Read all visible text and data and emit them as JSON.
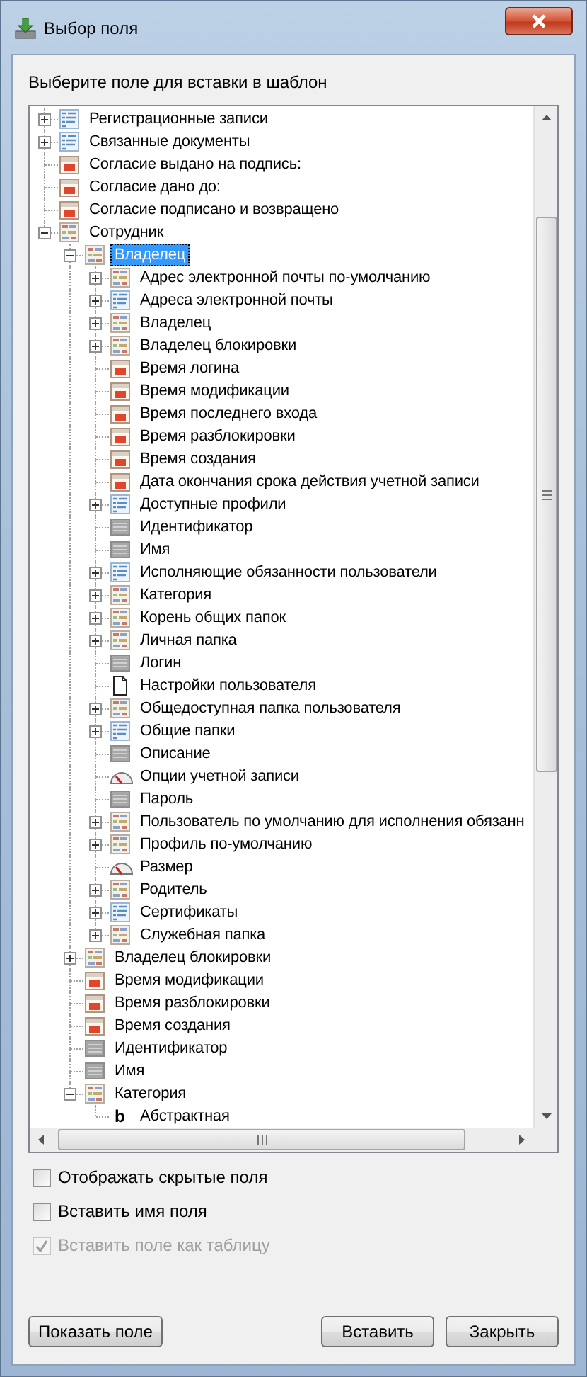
{
  "window": {
    "title": "Выбор поля"
  },
  "prompt": "Выберите поле для вставки в шаблон",
  "tree": [
    {
      "label": "Регистрационные записи",
      "kind": "list",
      "expanded": false,
      "selected": false
    },
    {
      "label": "Связанные документы",
      "kind": "list",
      "expanded": false,
      "selected": false
    },
    {
      "label": "Согласие выдано на подпись:",
      "kind": "date",
      "selected": false
    },
    {
      "label": "Согласие дано до:",
      "kind": "date",
      "selected": false
    },
    {
      "label": "Согласие подписано и возвращено",
      "kind": "date",
      "selected": false
    },
    {
      "label": "Сотрудник",
      "kind": "entity",
      "expanded": true,
      "selected": false,
      "children": [
        {
          "label": "Владелец",
          "kind": "entity",
          "expanded": true,
          "selected": true,
          "children": [
            {
              "label": "Адрес электронной почты по-умолчанию",
              "kind": "entity",
              "expanded": false,
              "selected": false
            },
            {
              "label": "Адреса электронной почты",
              "kind": "list",
              "expanded": false,
              "selected": false
            },
            {
              "label": "Владелец",
              "kind": "entity",
              "expanded": false,
              "selected": false
            },
            {
              "label": "Владелец блокировки",
              "kind": "entity",
              "expanded": false,
              "selected": false
            },
            {
              "label": "Время логина",
              "kind": "date",
              "selected": false
            },
            {
              "label": "Время модификации",
              "kind": "date",
              "selected": false
            },
            {
              "label": "Время последнего входа",
              "kind": "date",
              "selected": false
            },
            {
              "label": "Время разблокировки",
              "kind": "date",
              "selected": false
            },
            {
              "label": "Время создания",
              "kind": "date",
              "selected": false
            },
            {
              "label": "Дата окончания срока действия учетной записи",
              "kind": "date",
              "selected": false
            },
            {
              "label": "Доступные профили",
              "kind": "list",
              "expanded": false,
              "selected": false
            },
            {
              "label": "Идентификатор",
              "kind": "text",
              "selected": false
            },
            {
              "label": "Имя",
              "kind": "text",
              "selected": false
            },
            {
              "label": "Исполняющие обязанности пользователи",
              "kind": "list",
              "expanded": false,
              "selected": false
            },
            {
              "label": "Категория",
              "kind": "entity",
              "expanded": false,
              "selected": false
            },
            {
              "label": "Корень общих папок",
              "kind": "entity",
              "expanded": false,
              "selected": false
            },
            {
              "label": "Личная папка",
              "kind": "entity",
              "expanded": false,
              "selected": false
            },
            {
              "label": "Логин",
              "kind": "text",
              "selected": false
            },
            {
              "label": "Настройки пользователя",
              "kind": "file",
              "selected": false
            },
            {
              "label": "Общедоступная папка пользователя",
              "kind": "entity",
              "expanded": false,
              "selected": false
            },
            {
              "label": "Общие папки",
              "kind": "list",
              "expanded": false,
              "selected": false
            },
            {
              "label": "Описание",
              "kind": "text",
              "selected": false
            },
            {
              "label": "Опции учетной записи",
              "kind": "gauge",
              "selected": false
            },
            {
              "label": "Пароль",
              "kind": "text",
              "selected": false
            },
            {
              "label": "Пользователь по умолчанию для исполнения обязанн",
              "kind": "entity",
              "expanded": false,
              "selected": false
            },
            {
              "label": "Профиль по-умолчанию",
              "kind": "entity",
              "expanded": false,
              "selected": false
            },
            {
              "label": "Размер",
              "kind": "gauge",
              "selected": false
            },
            {
              "label": "Родитель",
              "kind": "entity",
              "expanded": false,
              "selected": false
            },
            {
              "label": "Сертификаты",
              "kind": "list",
              "expanded": false,
              "selected": false
            },
            {
              "label": "Служебная папка",
              "kind": "entity",
              "expanded": false,
              "selected": false
            }
          ]
        },
        {
          "label": "Владелец блокировки",
          "kind": "entity",
          "expanded": false,
          "selected": false
        },
        {
          "label": "Время модификации",
          "kind": "date",
          "selected": false
        },
        {
          "label": "Время разблокировки",
          "kind": "date",
          "selected": false
        },
        {
          "label": "Время создания",
          "kind": "date",
          "selected": false
        },
        {
          "label": "Идентификатор",
          "kind": "text",
          "selected": false
        },
        {
          "label": "Имя",
          "kind": "text",
          "selected": false
        },
        {
          "label": "Категория",
          "kind": "entity",
          "expanded": true,
          "selected": false,
          "children": [
            {
              "label": "Абстрактная",
              "kind": "bool",
              "glyph": "b",
              "selected": false
            }
          ]
        }
      ]
    }
  ],
  "options": [
    {
      "label": "Отображать скрытые поля",
      "checked": false,
      "disabled": false
    },
    {
      "label": "Вставить имя поля",
      "checked": false,
      "disabled": false
    },
    {
      "label": "Вставить поле как таблицу",
      "checked": true,
      "disabled": true
    }
  ],
  "buttons_left": [
    "Показать поле"
  ],
  "buttons_right": [
    "Вставить",
    "Закрыть"
  ]
}
